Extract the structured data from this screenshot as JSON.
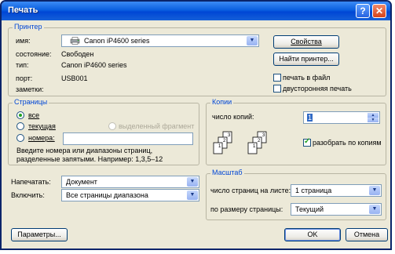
{
  "window": {
    "title": "Печать",
    "help_glyph": "?",
    "close_glyph": "✕"
  },
  "printer": {
    "group_title": "Принтер",
    "name_label": "имя:",
    "name_value": "Canon iP4600 series",
    "status_label": "состояние:",
    "status_value": "Свободен",
    "type_label": "тип:",
    "type_value": "Canon iP4600 series",
    "port_label": "порт:",
    "port_value": "USB001",
    "notes_label": "заметки:",
    "properties_button": "Свойства",
    "find_printer_button": "Найти принтер...",
    "print_to_file_label": "печать в файл",
    "duplex_label": "двусторонняя печать"
  },
  "pages": {
    "group_title": "Страницы",
    "all_label": "все",
    "current_label": "текущая",
    "selection_label": "выделенный фрагмент",
    "numbers_label": "номера:",
    "numbers_value": "",
    "hint": "Введите номера или диапазоны страниц, разделенные запятыми. Например: 1,3,5–12",
    "selected": "all"
  },
  "copies": {
    "group_title": "Копии",
    "count_label": "число копий:",
    "count_value": "1",
    "collate_label": "разобрать по копиям",
    "collate_checked": true,
    "page_numbers_stack": [
      "3",
      "2",
      "1"
    ]
  },
  "print_what": {
    "label": "Напечатать:",
    "value": "Документ"
  },
  "include": {
    "label": "Включить:",
    "value": "Все страницы диапазона"
  },
  "zoom": {
    "group_title": "Масштаб",
    "pages_per_sheet_label": "число страниц на листе:",
    "pages_per_sheet_value": "1 страница",
    "scale_label": "по размеру страницы:",
    "scale_value": "Текущий"
  },
  "footer": {
    "options_button": "Параметры...",
    "ok_button": "OK",
    "cancel_button": "Отмена"
  }
}
